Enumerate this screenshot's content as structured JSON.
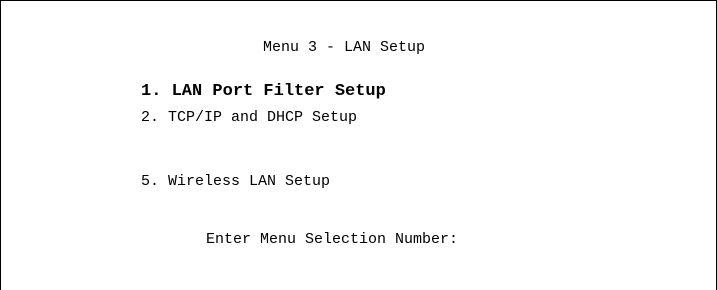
{
  "screen": {
    "title": "Menu 3 - LAN Setup",
    "menu_items": [
      {
        "label": "1. LAN Port Filter Setup",
        "selected": true
      },
      {
        "label": "2. TCP/IP and DHCP Setup",
        "selected": false
      },
      {
        "label": "5. Wireless LAN Setup",
        "selected": false
      }
    ],
    "prompt": "Enter Menu Selection Number:",
    "colors": {
      "background": "#ffffff",
      "text": "#000000",
      "border": "#000000"
    }
  }
}
